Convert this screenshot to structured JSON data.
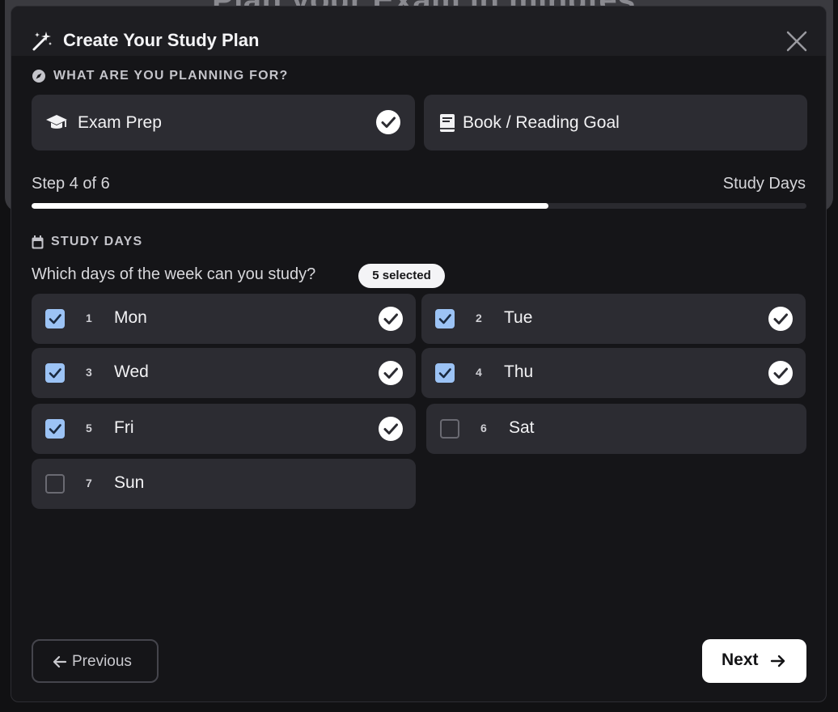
{
  "backdrop": {
    "heading": "Plan your Exam in minutes"
  },
  "modal": {
    "title": "Create Your Study Plan"
  },
  "planning_section": {
    "label": "WHAT ARE YOU PLANNING FOR?",
    "options": [
      {
        "label": "Exam Prep",
        "icon": "graduation-cap-icon",
        "selected": true
      },
      {
        "label": "Book / Reading Goal",
        "icon": "book-icon",
        "selected": false
      }
    ]
  },
  "progress": {
    "step_text": "Step 4 of 6",
    "step_name": "Study Days",
    "fraction": 0.667
  },
  "study_days": {
    "section_label": "STUDY DAYS",
    "question": "Which days of the week can you study?",
    "selected_badge": "5 selected",
    "days": [
      {
        "num": "1",
        "name": "Mon",
        "checked": true
      },
      {
        "num": "2",
        "name": "Tue",
        "checked": true
      },
      {
        "num": "3",
        "name": "Wed",
        "checked": true
      },
      {
        "num": "4",
        "name": "Thu",
        "checked": true
      },
      {
        "num": "5",
        "name": "Fri",
        "checked": true
      },
      {
        "num": "6",
        "name": "Sat",
        "checked": false
      },
      {
        "num": "7",
        "name": "Sun",
        "checked": false
      }
    ]
  },
  "footer": {
    "previous_label": "Previous",
    "next_label": "Next"
  },
  "colors": {
    "accent_checkbox": "#9cc3f5",
    "primary_button": "#ffffff",
    "card_bg": "#2c2c32"
  }
}
